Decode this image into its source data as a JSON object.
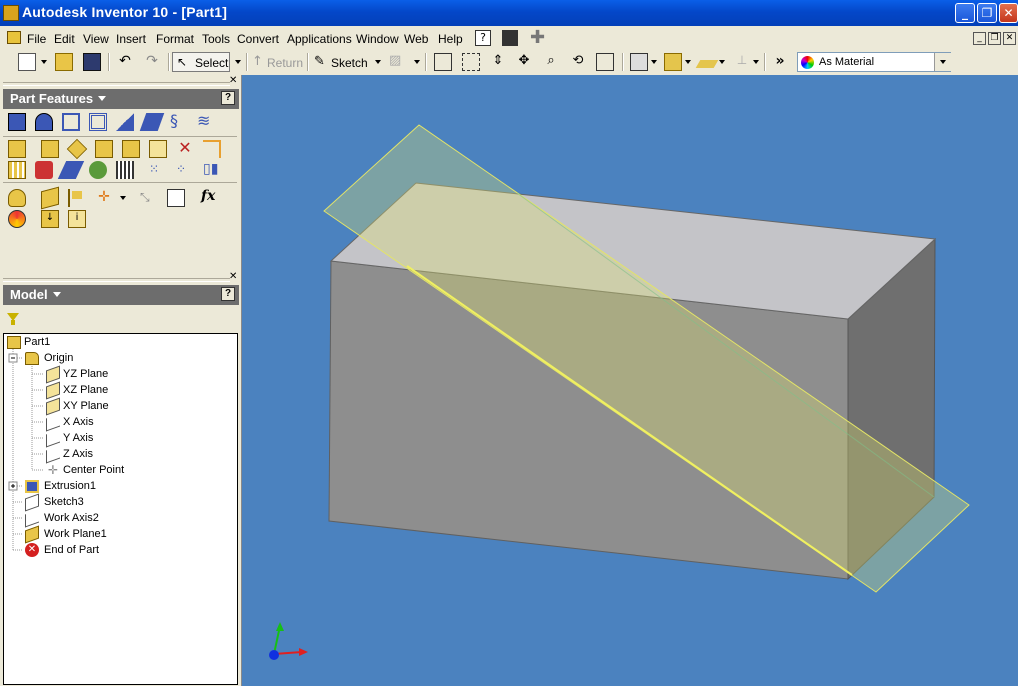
{
  "window": {
    "title": "Autodesk Inventor 10 - [Part1]"
  },
  "menu": [
    "File",
    "Edit",
    "View",
    "Insert",
    "Format",
    "Tools",
    "Convert",
    "Applications",
    "Window",
    "Web",
    "Help"
  ],
  "toolbar": {
    "select_label": "Select",
    "return_label": "Return",
    "sketch_label": "Sketch",
    "color_value": "As Material"
  },
  "features_panel": {
    "title": "Part Features"
  },
  "model_panel": {
    "title": "Model"
  },
  "tree": {
    "root": "Part1",
    "origin": "Origin",
    "origin_items": [
      "YZ Plane",
      "XZ Plane",
      "XY Plane",
      "X Axis",
      "Y Axis",
      "Z Axis",
      "Center Point"
    ],
    "items": [
      "Extrusion1",
      "Sketch3",
      "Work Axis2",
      "Work Plane1",
      "End of Part"
    ]
  },
  "fx_label": "fx",
  "colors": {
    "viewport_bg": "#4b82bf",
    "part_fill": "#9a9a9a",
    "workplane": "#d9e36a"
  }
}
